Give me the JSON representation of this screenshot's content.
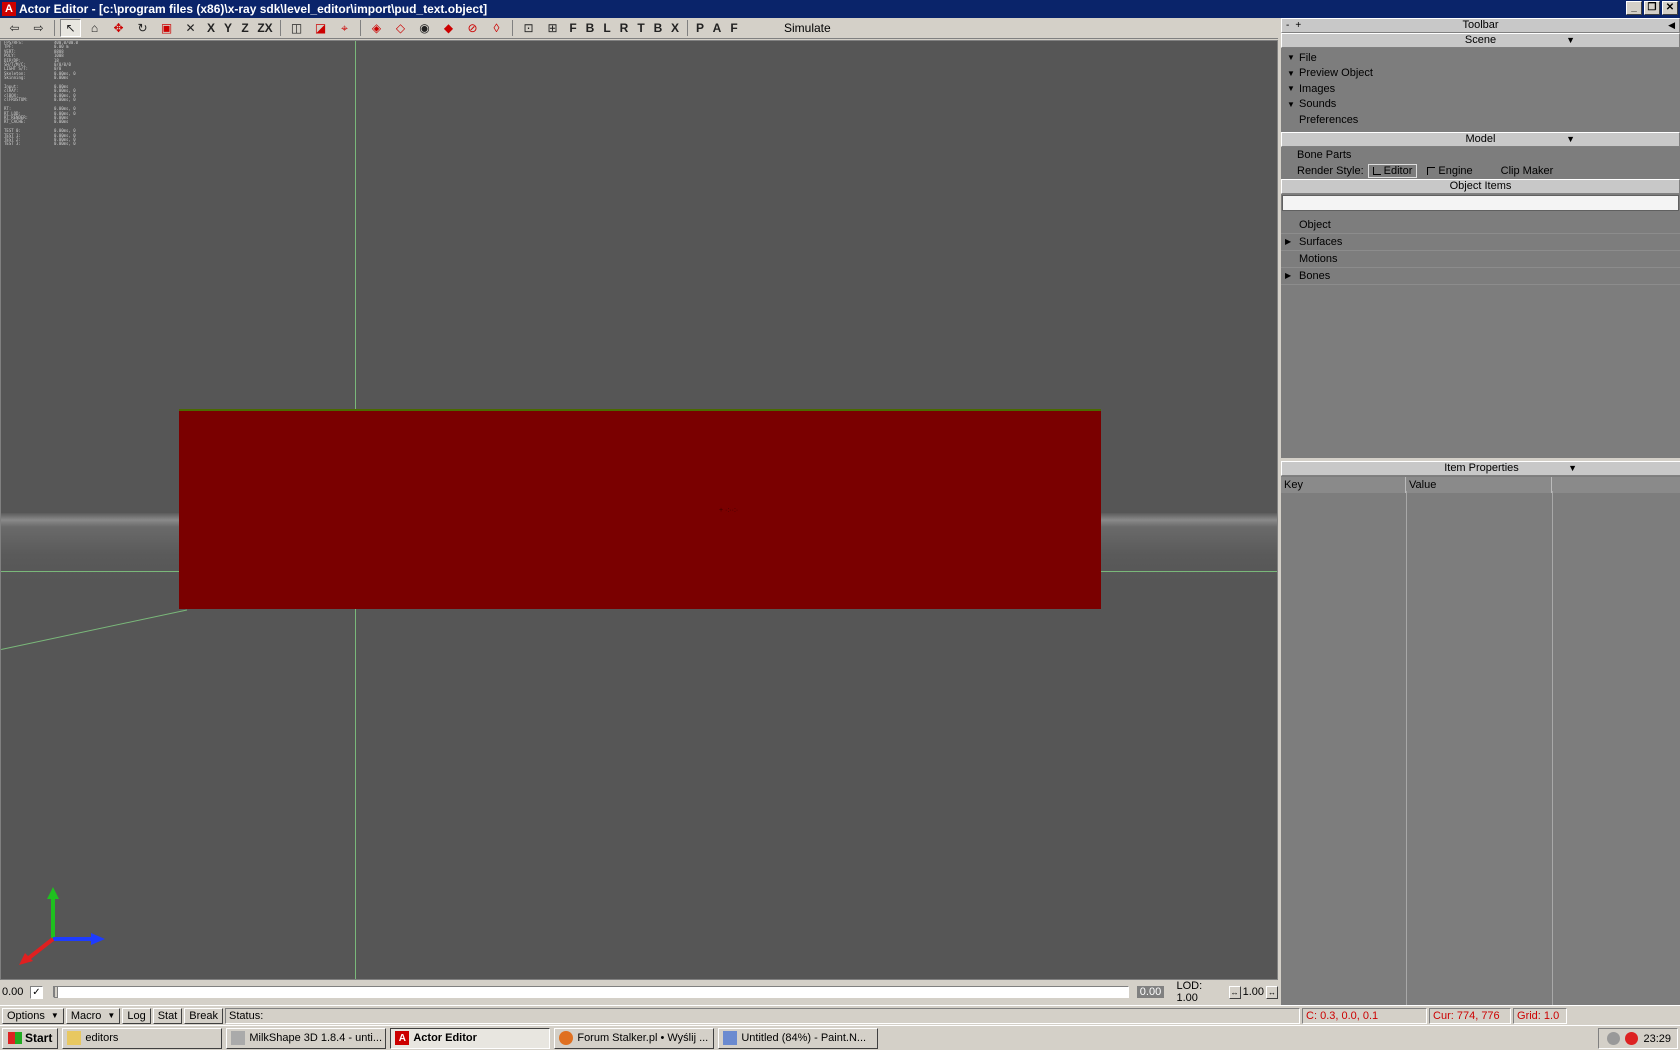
{
  "window": {
    "icon": "A",
    "title": "Actor Editor - [c:\\program files (x86)\\x-ray sdk\\level_editor\\import\\pud_text.object]",
    "controls": [
      "_",
      "❐",
      "✕"
    ]
  },
  "toolbar": {
    "axis_labels": [
      "X",
      "Y",
      "Z",
      "ZX"
    ],
    "view_labels": [
      "F",
      "B",
      "L",
      "R",
      "T",
      "B",
      "X"
    ],
    "mode_labels": [
      "P",
      "A",
      "F"
    ],
    "simulate_label": "Simulate"
  },
  "viewport": {
    "stats": [
      [
        "FPS/RFS:",
        "400.0/00.0"
      ],
      [
        "TPF:",
        "0.00 m"
      ],
      [
        "VERT:",
        "8888"
      ],
      [
        "POLY:",
        "1008"
      ],
      [
        "DIP/DP:",
        "18"
      ],
      [
        "SH/T/M/C:",
        "0/0/0/0"
      ],
      [
        "LIGHT S/T:",
        "0/0"
      ],
      [
        "Skeleton:",
        "0.00ms, 0"
      ],
      [
        "Skinning:",
        "0.00ms"
      ],
      [
        "",
        ""
      ],
      [
        "Input:",
        "0.00ms"
      ],
      [
        "clRAY:",
        "0.00ms, 0"
      ],
      [
        "clBOX:",
        "0.00ms, 0"
      ],
      [
        "clFRUSTUM:",
        "0.00ms, 0"
      ],
      [
        "",
        ""
      ],
      [
        "RT:",
        "0.00ms, 0"
      ],
      [
        "RT_LOD:",
        "0.00ms, 0"
      ],
      [
        "RT_RENDER:",
        "0.00ms"
      ],
      [
        "RT_CACHE:",
        "0.00ms"
      ],
      [
        "",
        ""
      ],
      [
        "TEST 0:",
        "0.00ms, 0"
      ],
      [
        "TEST 1:",
        "0.00ms, 0"
      ],
      [
        "TEST 2:",
        "0.00ms, 0"
      ],
      [
        "TEST 3:",
        "0.00ms, 0"
      ]
    ],
    "model_color": "#7a0000",
    "grid_color": "#7ab87a"
  },
  "timeline": {
    "start_value": "0.00",
    "end_value": "0.00",
    "lod_label": "LOD: 1.00",
    "lod_value": "1.00",
    "progress": 0
  },
  "statusbar": {
    "options": "Options",
    "macro": "Macro",
    "log": "Log",
    "stat": "Stat",
    "break": "Break",
    "status_label": "Status:",
    "coords": "C: 0.3, 0.0, 0.1",
    "cursor": "Cur: 774, 776",
    "grid": "Grid: 1.0"
  },
  "taskbar": {
    "start": "Start",
    "tasks": [
      {
        "label": "editors",
        "icon": "folder-icon"
      },
      {
        "label": "MilkShape 3D 1.8.4 - unti...",
        "icon": "milkshape-icon"
      },
      {
        "label": "Actor Editor",
        "icon": "actor-editor-icon",
        "active": true
      },
      {
        "label": "Forum Stalker.pl • Wyślij ...",
        "icon": "firefox-icon"
      },
      {
        "label": "Untitled (84%) - Paint.N...",
        "icon": "paint-icon"
      }
    ],
    "clock": "23:29"
  },
  "panel": {
    "toolbar_title": "Toolbar",
    "scene_title": "Scene",
    "scene_items": [
      {
        "label": "File",
        "expandable": true
      },
      {
        "label": "Preview Object",
        "expandable": true
      },
      {
        "label": "Images",
        "expandable": true
      },
      {
        "label": "Sounds",
        "expandable": true
      },
      {
        "label": "Preferences",
        "expandable": false
      }
    ],
    "model_title": "Model",
    "bone_parts": "Bone Parts",
    "render_style_label": "Render Style:",
    "render_editor": "Editor",
    "render_engine": "Engine",
    "clip_maker": "Clip Maker",
    "object_items_title": "Object Items",
    "object_items": [
      {
        "label": "Object",
        "expandable": false
      },
      {
        "label": "Surfaces",
        "expandable": true
      },
      {
        "label": "Motions",
        "expandable": false
      },
      {
        "label": "Bones",
        "expandable": true
      }
    ],
    "item_properties_title": "Item Properties",
    "key_col": "Key",
    "value_col": "Value"
  }
}
